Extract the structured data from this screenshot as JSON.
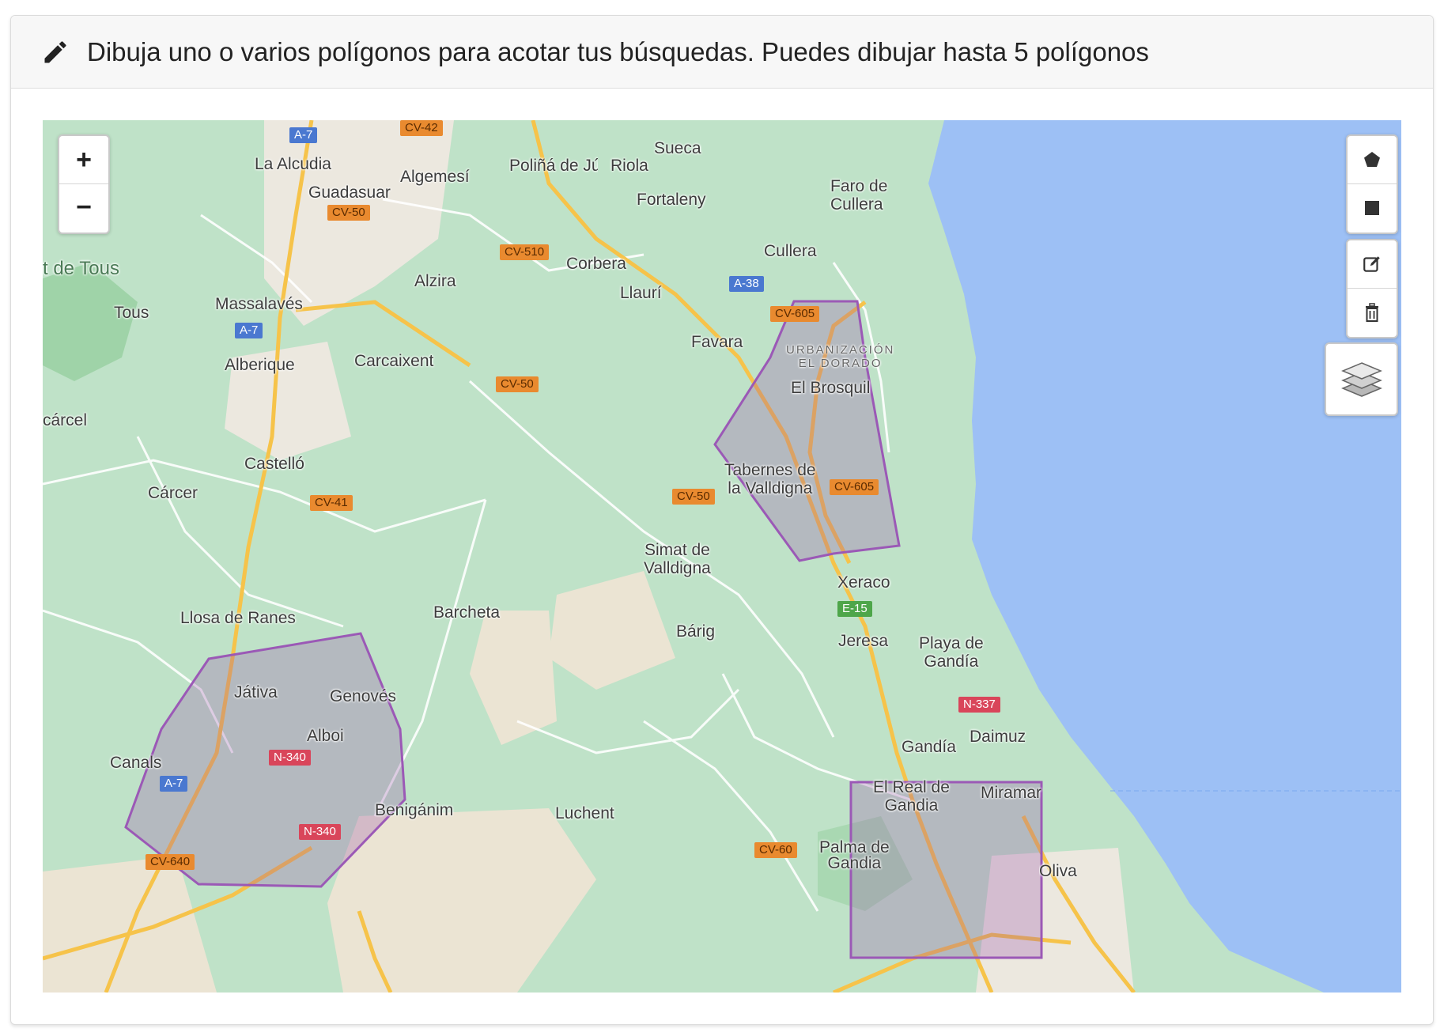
{
  "header": {
    "icon": "pencil-icon",
    "text": "Dibuja uno o varios polígonos para acotar tus búsquedas. Puedes dibujar hasta 5 polígonos"
  },
  "map": {
    "colors": {
      "land": "#bfe2c8",
      "sea": "#9dc0f5",
      "urban": "#e8e6e3",
      "road_major": "#f6c34a",
      "polygon_stroke": "#9b59b6",
      "polygon_fill": "rgba(150,80,170,0.28)"
    },
    "zoom_controls": {
      "zoom_in": "+",
      "zoom_out": "−"
    },
    "draw_tools": [
      "pentagon-icon",
      "square-icon",
      "edit-icon",
      "trash-icon"
    ],
    "layers_icon": "layers-icon",
    "drawn_polygons": 3,
    "place_labels": {
      "la_alcudia": "La Alcudia",
      "guadasuar": "Guadasuar",
      "algemesi": "Algemesí",
      "polina": "Poliñá de Júcar",
      "riola": "Riola",
      "sueca": "Sueca",
      "fortaleny": "Fortaleny",
      "faro_cullera": "Faro de\nCullera",
      "tous_lake": "t de Tous",
      "tous": "Tous",
      "massalaves": "Massalavés",
      "alzira": "Alzira",
      "corbera": "Corbera",
      "llauri": "Llaurí",
      "cullera": "Cullera",
      "alberique": "Alberique",
      "carcaixent": "Carcaixent",
      "favara": "Favara",
      "urbanizacion": "URBANIZACIÓN\nEL DORADO",
      "el_brosquil": "El Brosquil",
      "carcel": "cárcel",
      "castello": "Castelló",
      "carcer": "Cárcer",
      "tabernes": "Tabernes de\nla Valldigna",
      "simat": "Simat de\nValldigna",
      "xeraco": "Xeraco",
      "llosa": "Llosa de Ranes",
      "barcheta": "Barcheta",
      "barig": "Bárig",
      "jeresa": "Jeresa",
      "playa_gandia": "Playa de\nGandía",
      "jativa": "Játiva",
      "genoves": "Genovés",
      "albaida": "Alboi",
      "canals": "Canals",
      "gandia": "Gandía",
      "daimuz": "Daimuz",
      "el_real": "El Real de\nGandia",
      "miramar": "Miramar",
      "beniganim": "Benigánim",
      "lluchent": "Luchent",
      "palma": "Palma de\nGandia",
      "oliva": "Oliva"
    },
    "road_shields": {
      "a7_top": "A-7",
      "cv42": "CV-42",
      "cv50_a": "CV-50",
      "cv510": "CV-510",
      "a7_mid": "A-7",
      "a38": "A-38",
      "cv605_a": "CV-605",
      "cv50_b": "CV-50",
      "cv41": "CV-41",
      "cv50_c": "CV-50",
      "cv605_b": "CV-605",
      "e15": "E-15",
      "n337": "N-337",
      "n340_a": "N-340",
      "a7_bot": "A-7",
      "n340_b": "N-340",
      "cv640": "CV-640",
      "cv60": "CV-60"
    }
  }
}
